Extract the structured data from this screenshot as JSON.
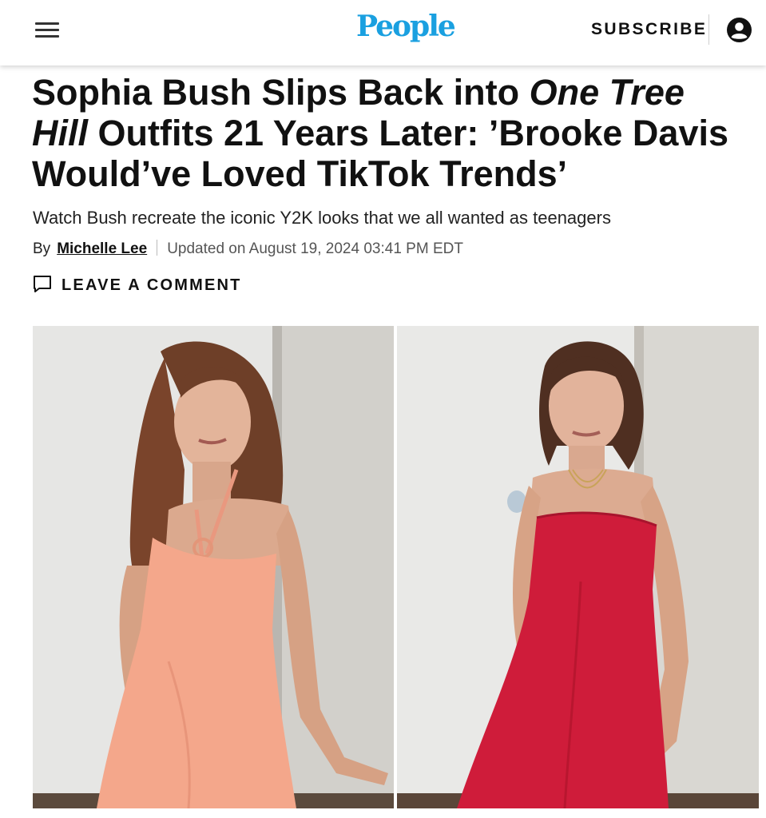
{
  "header": {
    "logo": "People",
    "subscribe_label": "SUBSCRIBE",
    "menu_icon": "hamburger-menu-icon",
    "account_icon": "account-circle-icon",
    "brand_color": "#1aa0e0"
  },
  "article": {
    "title_part1": "Sophia Bush Slips Back into ",
    "title_show": "One Tree Hill",
    "title_part2": " Outfits 21 Years Later: ’Brooke Davis Would’ve Loved TikTok Trends’",
    "dek": "Watch Bush recreate the iconic Y2K looks that we all wanted as teenagers",
    "byline_prefix": "By",
    "author": "Michelle Lee",
    "updated": "Updated on August 19, 2024 03:41 PM EDT",
    "comment_label": "LEAVE A COMMENT",
    "comment_icon": "comment-bubble-icon"
  },
  "images": {
    "left": "woman-in-peach-halter-dress",
    "right": "woman-in-red-strapless-dress"
  }
}
